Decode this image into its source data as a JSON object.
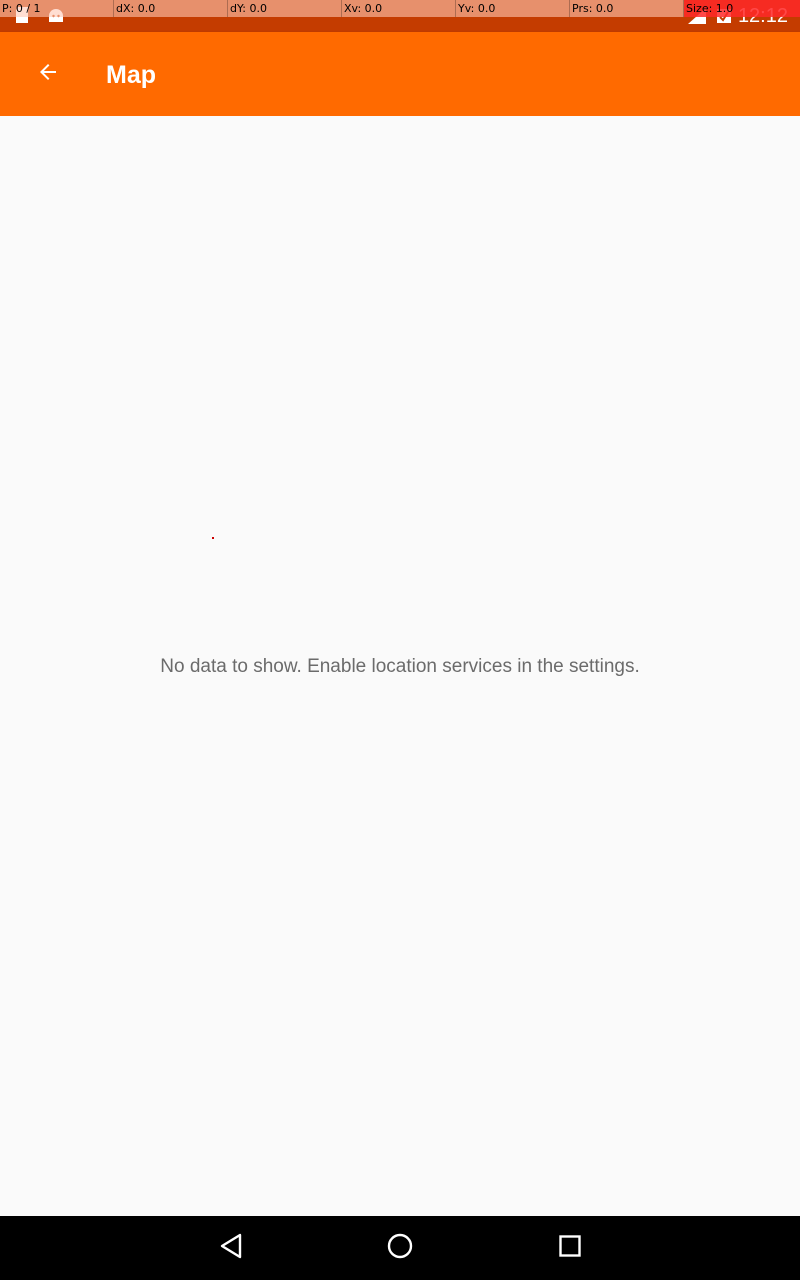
{
  "status_bar": {
    "time": "12:12",
    "background_color": "#c43c00",
    "left_icons": [
      "sd-card-icon",
      "android-debug-icon"
    ],
    "right_icons": [
      "signal-icon",
      "battery-icon"
    ]
  },
  "pointer_overlay": {
    "p": "P: 0 / 1",
    "dx": "dX: 0.0",
    "dy": "dY: 0.0",
    "xv": "Xv: 0.0",
    "yv": "Yv: 0.0",
    "prs": "Prs: 0.0",
    "size": "Size: 1.0"
  },
  "app_bar": {
    "title": "Map",
    "back_icon": "arrow-back-icon",
    "color": "#ff6a00"
  },
  "content": {
    "empty_message": "No data to show. Enable location services in the settings."
  },
  "nav_bar": {
    "back_icon": "nav-back-icon",
    "home_icon": "nav-home-icon",
    "recents_icon": "nav-recents-icon"
  }
}
